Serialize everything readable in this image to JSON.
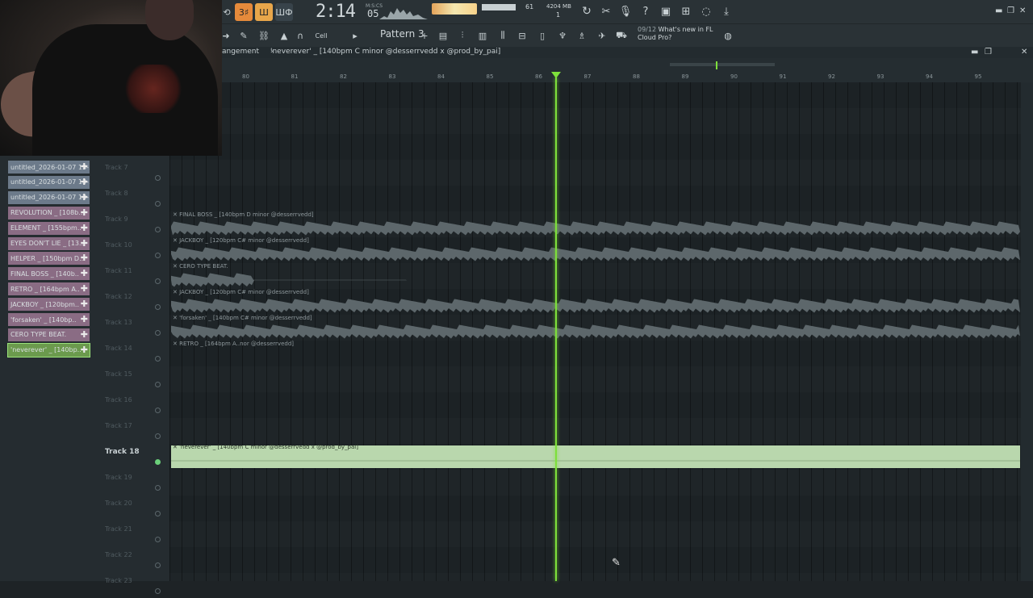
{
  "toolbar": {
    "mode_buttons": [
      "3♯",
      "Ш",
      "ШФ"
    ],
    "time": "2:14",
    "time_ms": "05",
    "time_unit": "M:S:CS",
    "cpu": "61",
    "memory": "4204 MB",
    "memory_sub": "1",
    "pattern_label": "Pattern 3",
    "snap_label": "Cell",
    "news_date": "09/12",
    "news_line1": "What's new in FL",
    "news_line2": "Cloud Pro?"
  },
  "playlist": {
    "title_prefix": "angement",
    "title": "'neverever' _ [140bpm C minor @desserrvedd x @prod_by_pai]"
  },
  "ruler": [
    "80",
    "81",
    "82",
    "83",
    "84",
    "85",
    "86",
    "87",
    "88",
    "89",
    "90",
    "91",
    "92",
    "93",
    "94",
    "95"
  ],
  "browser": [
    {
      "label": "untitled_2026-01-07 13-..",
      "color": "#6c7a8a"
    },
    {
      "label": "untitled_2026-01-07 13-..",
      "color": "#6c7a8a"
    },
    {
      "label": "untitled_2026-01-07 13-..",
      "color": "#6c7a8a"
    },
    {
      "label": "REVOLUTION _ [108b..",
      "color": "#8a6c84"
    },
    {
      "label": "ELEMENT _ [155bpm..",
      "color": "#8a6c84"
    },
    {
      "label": "EYES DON'T LIE _ [13..",
      "color": "#8a6c84"
    },
    {
      "label": "HELPER _ [150bpm D..",
      "color": "#8a6c84"
    },
    {
      "label": "FINAL BOSS _ [140b..",
      "color": "#8a6c84"
    },
    {
      "label": "RETRO _ [164bpm A..",
      "color": "#8a6c84"
    },
    {
      "label": "JACKBOY _ [120bpm..",
      "color": "#8a6c84"
    },
    {
      "label": "'forsaken' _ [140bp..",
      "color": "#8a6c84"
    },
    {
      "label": "CERO TYPE BEAT.",
      "color": "#8a6c84"
    },
    {
      "label": "'neverever' _ [140bp..",
      "color": "#6b9a4d"
    }
  ],
  "tracks": [
    "Track 7",
    "Track 8",
    "Track 9",
    "Track 10",
    "Track 11",
    "Track 12",
    "Track 13",
    "Track 14",
    "Track 15",
    "Track 16",
    "Track 17",
    "Track 18",
    "Track 19",
    "Track 20",
    "Track 21",
    "Track 22",
    "Track 23"
  ],
  "active_track": "Track 18",
  "clips": [
    {
      "label": "FINAL BOSS _ [140bpm D minor @desserrvedd]"
    },
    {
      "label": "JACKBOY _ [120bpm C# minor @desserrvedd]"
    },
    {
      "label": "CERO TYPE BEAT."
    },
    {
      "label": "JACKBOY _ [120bpm C# minor @desserrvedd]"
    },
    {
      "label": "'forsaken' _ [140bpm C# minor @desserrvedd]"
    },
    {
      "label": "RETRO _ [164bpm A..nor @desserrvedd]"
    },
    {
      "label": "'neverever' _ [140bpm C minor @desserrvedd x @prod_by_pai]"
    }
  ],
  "colors": {
    "playhead": "#7ee03b",
    "active_clip": "#b9d7ad",
    "clip": "#5d676b"
  }
}
